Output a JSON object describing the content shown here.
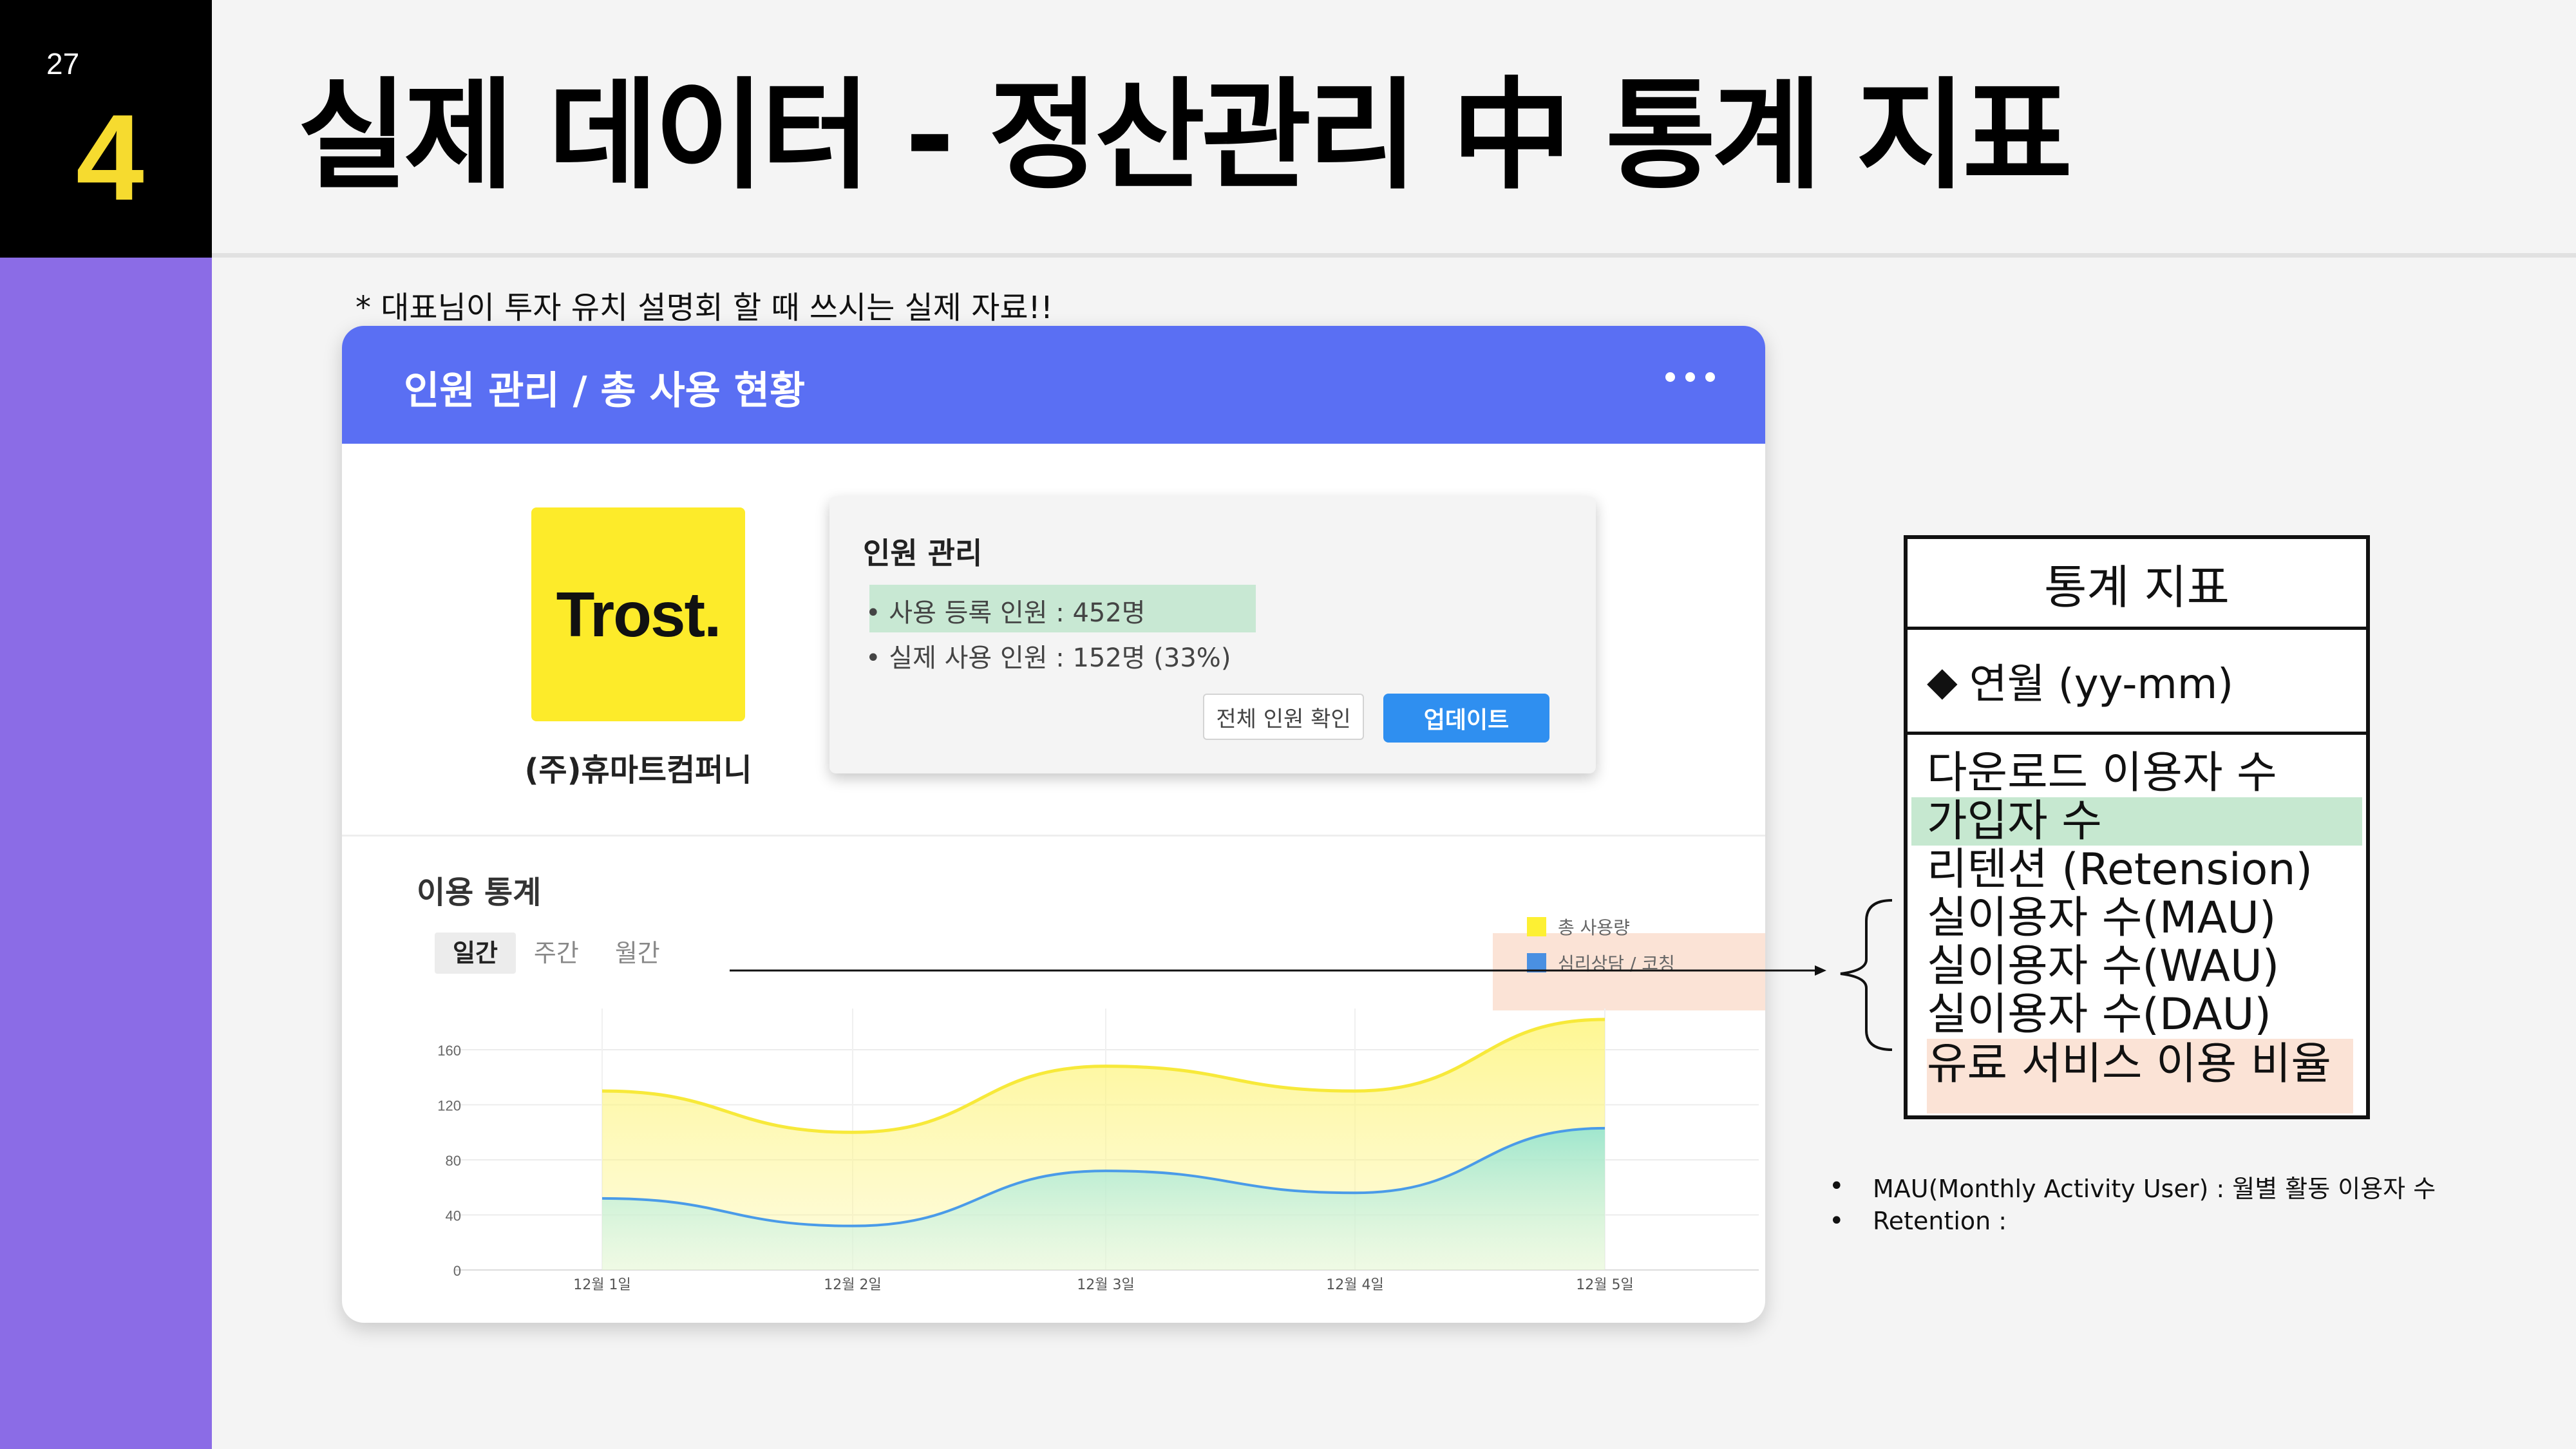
{
  "slide": {
    "page_number": "27",
    "section_number": "4",
    "title": "실제 데이터 - 정산관리 中 통계 지표",
    "note": "* 대표님이 투자 유치 설명회 할 때 쓰시는 실제 자료!!"
  },
  "card": {
    "header_title": "인원 관리 / 총 사용 현황",
    "menu_icon": "more-dots-icon",
    "logo_text": "Trost.",
    "company_name": "(주)휴마트컴퍼니",
    "management": {
      "title": "인원 관리",
      "registered": "• 사용 등록 인원 : 452명",
      "actual": "• 실제 사용 인원 : 152명 (33%)",
      "btn_view_all": "전체 인원 확인",
      "btn_update": "업데이트"
    },
    "stats_title": "이용 통계",
    "tabs": [
      "일간",
      "주간",
      "월간"
    ],
    "active_tab": "일간"
  },
  "colors": {
    "header": "#5a6ff3",
    "total_usage": "#fdf033",
    "counseling": "#4a90e2",
    "highlight_green": "#c6e8d0",
    "highlight_peach": "#fbe3d6"
  },
  "chart_data": {
    "type": "area",
    "categories": [
      "12월 1일",
      "12월 2일",
      "12월 3일",
      "12월 4일",
      "12월 5일"
    ],
    "series": [
      {
        "name": "총 사용량",
        "values": [
          130,
          100,
          148,
          130,
          182
        ]
      },
      {
        "name": "심리상담 / 코칭",
        "values": [
          52,
          32,
          72,
          56,
          103
        ]
      }
    ],
    "yticks": [
      "160",
      "120",
      "80",
      "40",
      "0"
    ],
    "ylim": [
      0,
      180
    ],
    "grid": true,
    "legend_position": "top-right"
  },
  "stats_panel": {
    "title": "통계 지표",
    "period": "연월 (yy-mm)",
    "items": [
      "다운로드 이용자 수",
      "가입자 수",
      "리텐션 (Retension)",
      "실이용자 수(MAU)",
      "실이용자 수(WAU)",
      "실이용자 수(DAU)",
      "유료 서비스 이용 비율"
    ]
  },
  "definitions": [
    "MAU(Monthly Activity User) : 월별 활동 이용자 수",
    "Retention :"
  ]
}
